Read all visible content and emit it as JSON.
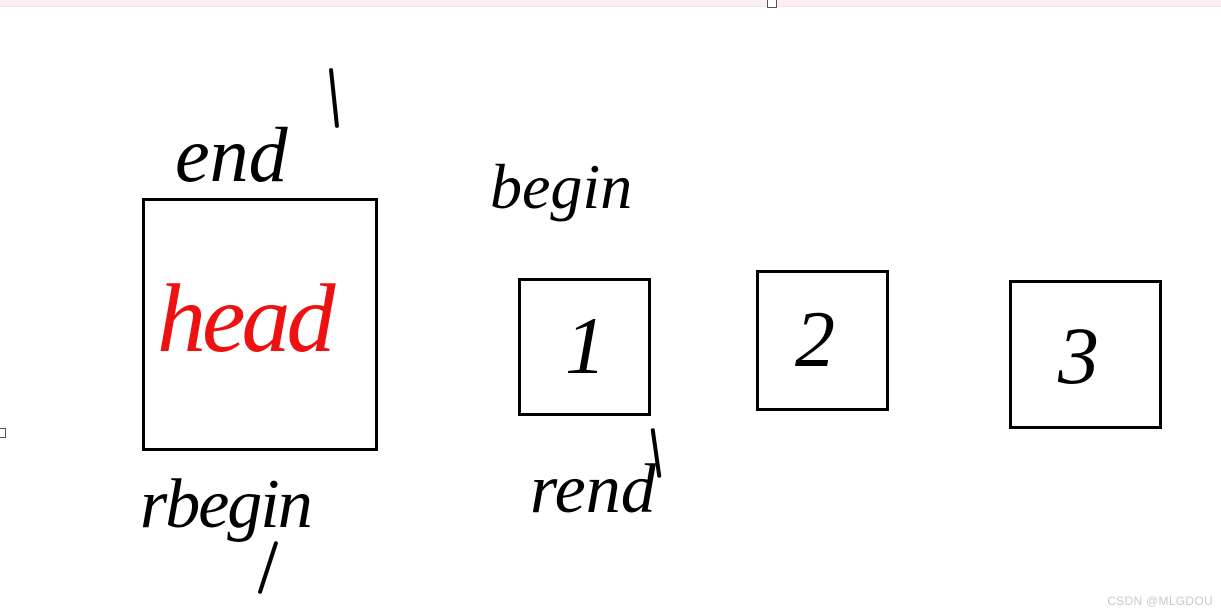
{
  "labels": {
    "end": "end",
    "begin": "begin",
    "rbegin": "rbegin",
    "rend": "rend"
  },
  "nodes": {
    "head": "head",
    "n1": "1",
    "n2": "2",
    "n3": "3"
  },
  "watermark": "CSDN @MLGDOU"
}
